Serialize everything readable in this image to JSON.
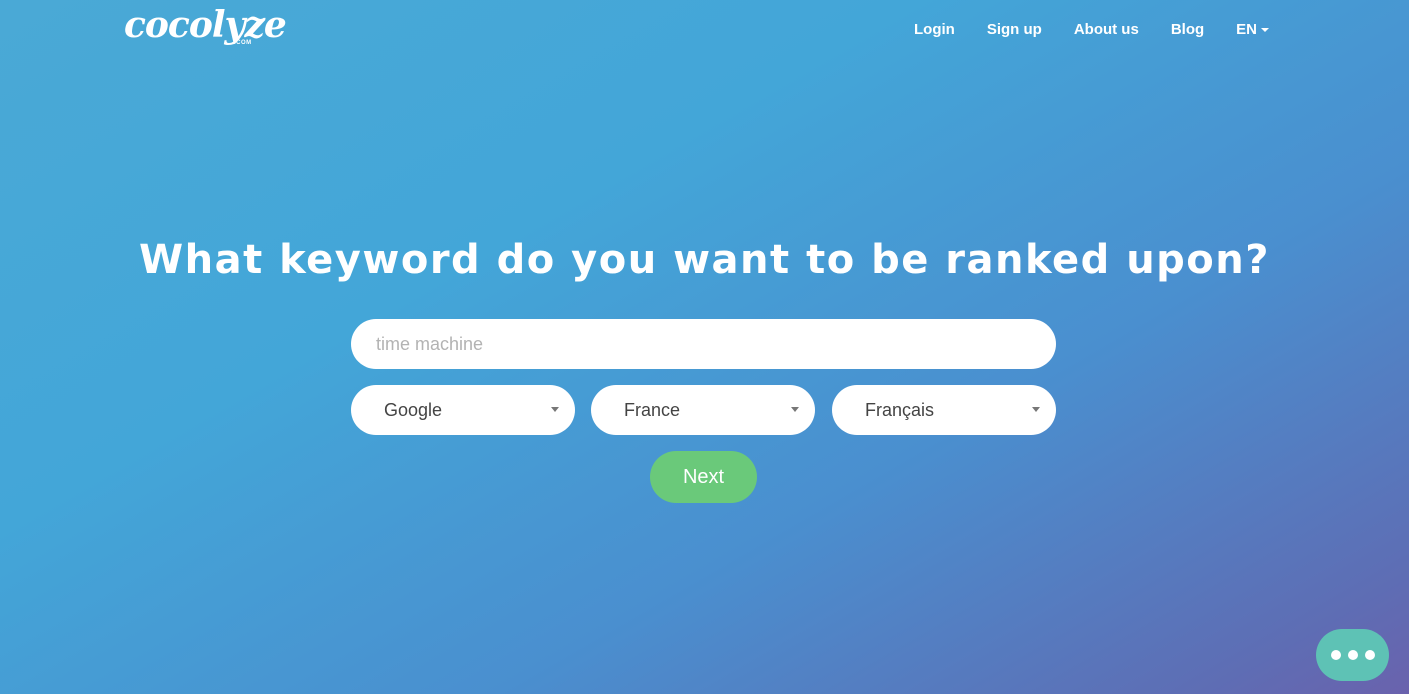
{
  "logo": {
    "name": "cocolyze",
    "suffix": ".COM"
  },
  "nav": {
    "login": "Login",
    "signup": "Sign up",
    "about": "About us",
    "blog": "Blog",
    "language": "EN"
  },
  "hero": {
    "headline": "What keyword do you want to be ranked upon?",
    "keyword_placeholder": "time machine",
    "keyword_value": ""
  },
  "selects": {
    "engine": "Google",
    "country": "France",
    "language": "Français"
  },
  "actions": {
    "next": "Next"
  },
  "colors": {
    "gradient_start": "#4aa9d6",
    "gradient_end": "#6a62ad",
    "next_button": "#6ac97a",
    "chat_button": "#5ec2b5"
  },
  "icons": {
    "dropdown": "caret-down",
    "chat": "three-dots"
  }
}
